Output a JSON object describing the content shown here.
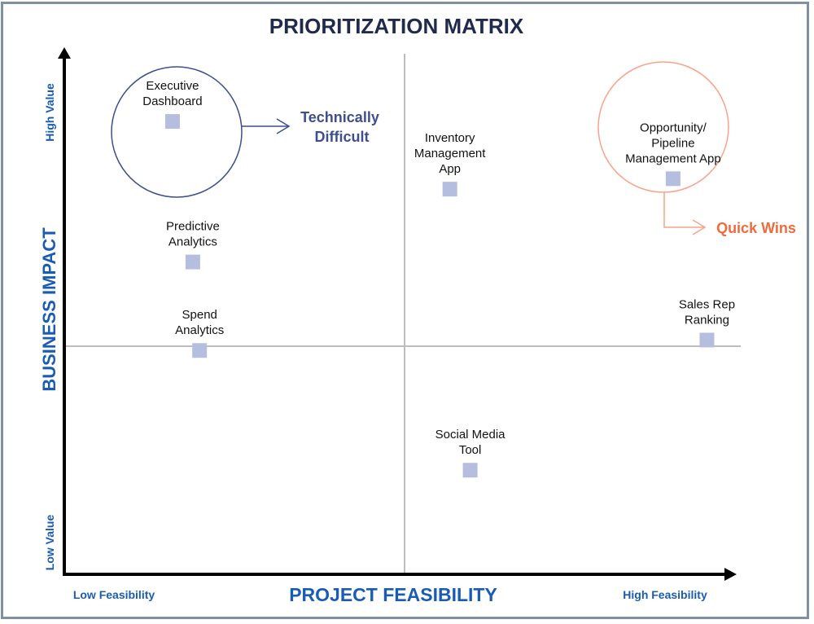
{
  "title": "PRIORITIZATION MATRIX",
  "axes": {
    "x_label": "PROJECT FEASIBILITY",
    "y_label": "BUSINESS IMPACT",
    "x_low": "Low Feasibility",
    "x_high": "High Feasibility",
    "y_low": "Low Value",
    "y_high": "High Value"
  },
  "callouts": {
    "technically_difficult": [
      "Technically",
      "Difficult"
    ],
    "quick_wins": "Quick Wins"
  },
  "colors": {
    "title": "#1f2a4d",
    "axis_text": "#1a5cb4",
    "marker": "#b6bedf",
    "difficult": "#3e4e8e",
    "quick_wins": "#f06a3c",
    "quick_wins_line": "#f9a38b"
  },
  "chart_data": {
    "type": "scatter",
    "title": "PRIORITIZATION MATRIX",
    "xlabel": "PROJECT FEASIBILITY",
    "ylabel": "BUSINESS IMPACT",
    "xlim": [
      0,
      10
    ],
    "ylim": [
      0,
      10
    ],
    "quadrant_dividers": {
      "x": 5,
      "y": 4.3
    },
    "points": [
      {
        "label": [
          "Executive",
          "Dashboard"
        ],
        "x": 1.6,
        "y": 8.7,
        "highlight": "technically-difficult"
      },
      {
        "label": [
          "Predictive",
          "Analytics"
        ],
        "x": 1.9,
        "y": 6.0
      },
      {
        "label": [
          "Spend",
          "Analytics"
        ],
        "x": 2.0,
        "y": 4.3
      },
      {
        "label": [
          "Inventory",
          "Management",
          "App"
        ],
        "x": 5.7,
        "y": 7.4
      },
      {
        "label": [
          "Opportunity/",
          "Pipeline",
          "Management App"
        ],
        "x": 9.0,
        "y": 7.6,
        "highlight": "quick-wins"
      },
      {
        "label": [
          "Sales Rep",
          "Ranking"
        ],
        "x": 9.5,
        "y": 4.5
      },
      {
        "label": [
          "Social Media",
          "Tool"
        ],
        "x": 6.0,
        "y": 2.0
      }
    ]
  }
}
